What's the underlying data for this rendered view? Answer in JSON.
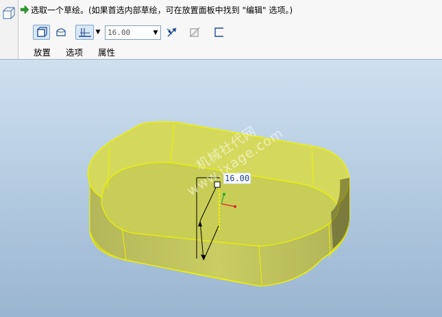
{
  "dashboard": {
    "prompt": "选取一个草绘。(如果首选内部草绘，可在放置面板中找到 \"编辑\" 选项。)",
    "depth_value": "16.00",
    "tabs": [
      "放置",
      "选项",
      "属性"
    ]
  },
  "graphics": {
    "dimension_label": "16.00",
    "watermark_lines": [
      "机械社代网",
      "www.jxage.com"
    ]
  },
  "icons": {
    "feature": "extrude-feature-icon",
    "prompt": "green-arrow-icon",
    "solid": "extrude-solid-icon",
    "surface": "extrude-surface-icon",
    "depth_option": "blind-depth-icon",
    "flip": "flip-direction-icon",
    "remove_material": "remove-material-icon",
    "thicken": "thicken-sketch-icon"
  },
  "colors": {
    "model_fill": "#c8cf5a",
    "model_edge": "#f0f000",
    "viewport_top": "#cfe0ef",
    "viewport_bottom": "#9ab5d1"
  }
}
